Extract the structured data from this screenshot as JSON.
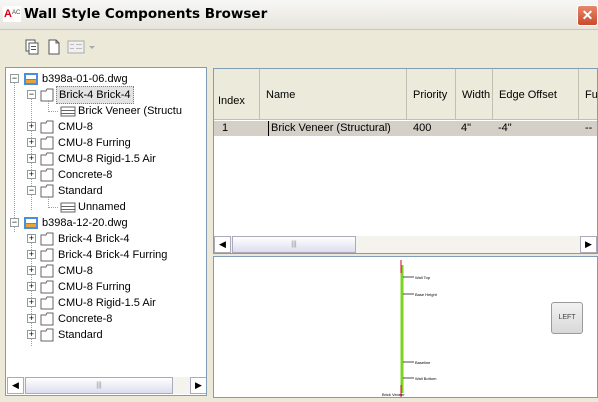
{
  "window": {
    "title": "Wall Style Components Browser",
    "close_glyph": "✕"
  },
  "toolbar": {
    "icons": [
      "browse-icon",
      "new-icon",
      "view-menu-icon"
    ]
  },
  "tree": {
    "nodes": [
      {
        "label": "b398a-01-06.dwg",
        "type": "file",
        "expanded": true
      },
      {
        "label": "Brick-4 Brick-4",
        "type": "folder",
        "expanded": true,
        "selected": true
      },
      {
        "label": "Brick Veneer (Structu",
        "type": "component"
      },
      {
        "label": "CMU-8",
        "type": "folder"
      },
      {
        "label": "CMU-8 Furring",
        "type": "folder"
      },
      {
        "label": "CMU-8 Rigid-1.5 Air",
        "type": "folder"
      },
      {
        "label": "Concrete-8",
        "type": "folder"
      },
      {
        "label": "Standard",
        "type": "folder",
        "expanded": true
      },
      {
        "label": "Unnamed",
        "type": "component"
      },
      {
        "label": "b398a-12-20.dwg",
        "type": "file",
        "expanded": true
      },
      {
        "label": "Brick-4 Brick-4",
        "type": "folder"
      },
      {
        "label": "Brick-4 Brick-4 Furring",
        "type": "folder"
      },
      {
        "label": "CMU-8",
        "type": "folder"
      },
      {
        "label": "CMU-8 Furring",
        "type": "folder"
      },
      {
        "label": "CMU-8 Rigid-1.5 Air",
        "type": "folder"
      },
      {
        "label": "Concrete-8",
        "type": "folder"
      },
      {
        "label": "Standard",
        "type": "folder"
      }
    ],
    "scroll_thumb_glyph": "|||"
  },
  "grid": {
    "columns": [
      "Index",
      "Name",
      "Priority",
      "Width",
      "Edge Offset",
      "Fu"
    ],
    "rows": [
      {
        "index": "1",
        "name": "Brick Veneer (Structural)",
        "priority": "400",
        "width": "4\"",
        "edge_offset": "-4\"",
        "fu": "--"
      }
    ],
    "scroll_thumb_glyph": "|||"
  },
  "preview": {
    "labels": [
      "Wall Top",
      "Base Height",
      "Baseline",
      "Wall Bottom"
    ],
    "bottom_label": "Brick Veneer",
    "view_button": "LEFT",
    "colors": {
      "wall_line": "#7ed321",
      "marker": "#d0021b"
    }
  },
  "expander": {
    "expanded": "−",
    "collapsed": "+"
  },
  "scroll": {
    "left": "◀",
    "right": "▶"
  }
}
